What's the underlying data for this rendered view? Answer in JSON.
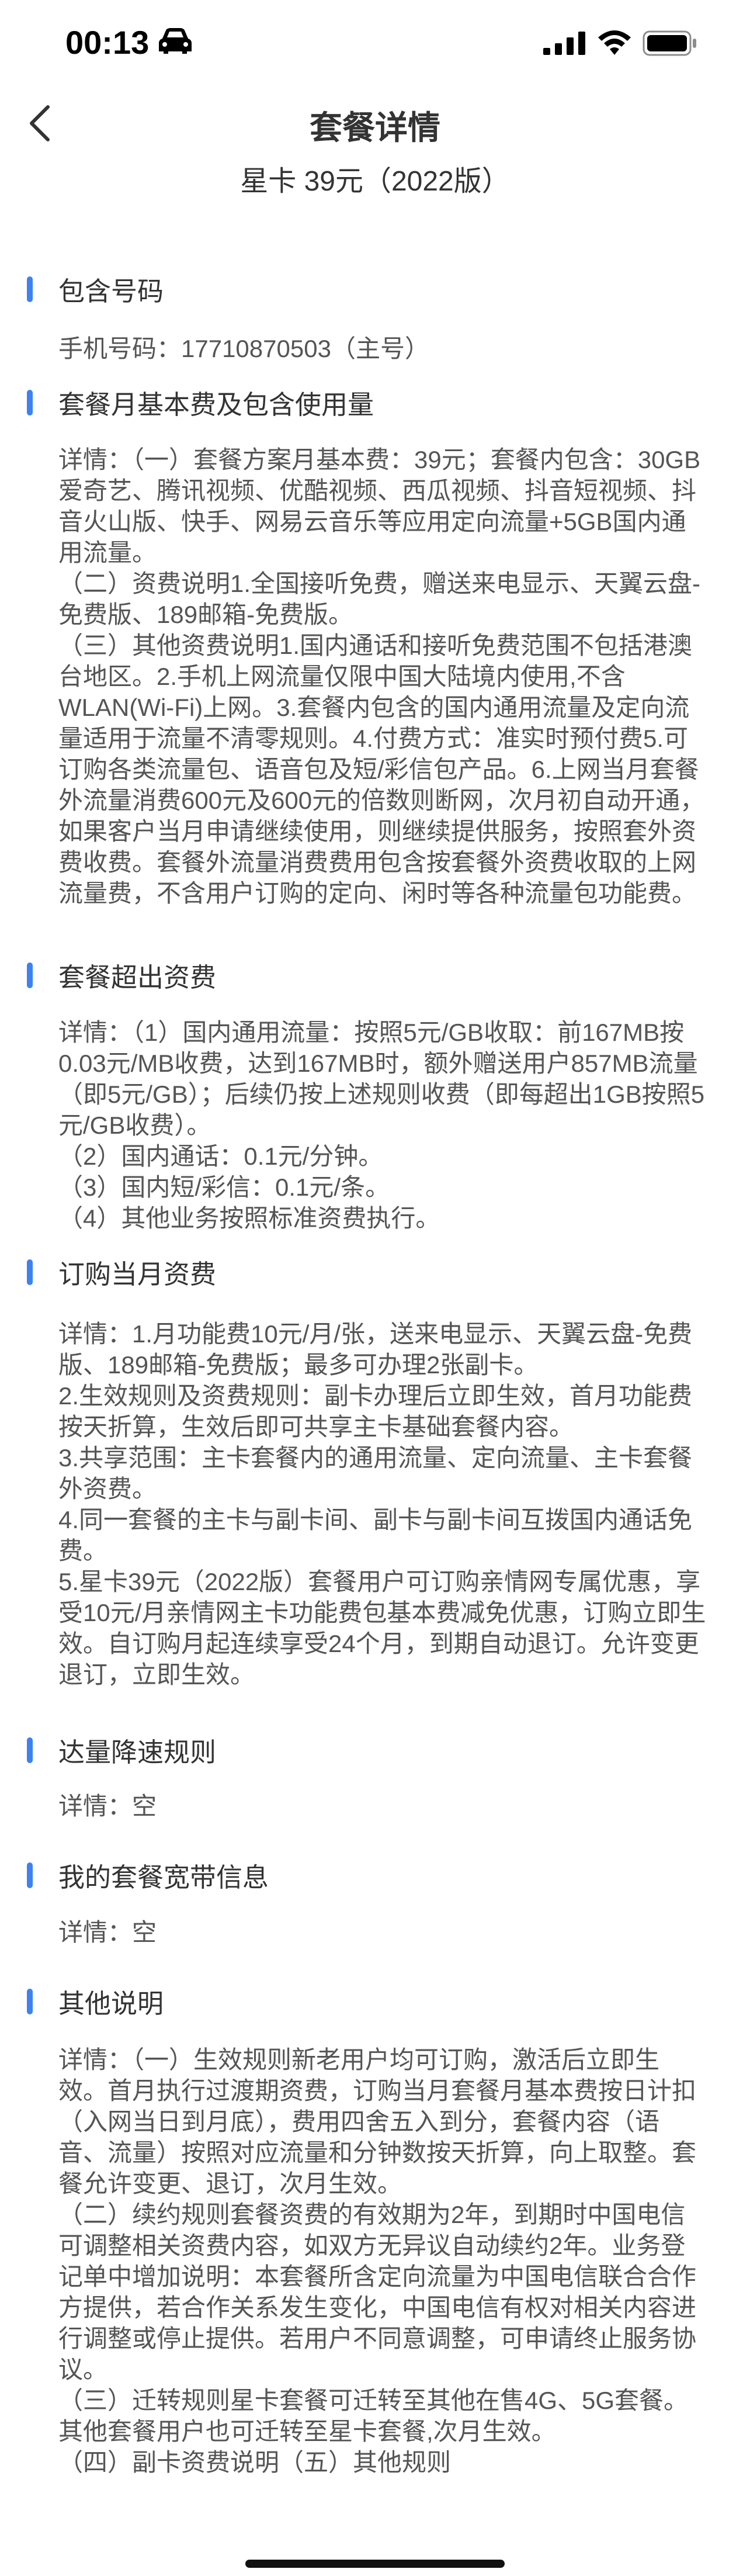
{
  "status_bar": {
    "time": "00:13",
    "icons": [
      "car-icon",
      "signal-icon",
      "wifi-icon",
      "battery-icon"
    ]
  },
  "nav": {
    "title": "套餐详情",
    "back_icon": "chevron-left-icon"
  },
  "plan_name": "星卡 39元（2022版）",
  "colors": {
    "accent": "#3b82f6",
    "text": "#333333",
    "body_text": "#555555"
  },
  "sections": [
    {
      "title": "包含号码",
      "body": "手机号码：17710870503（主号）"
    },
    {
      "title": "套餐月基本费及包含使用量",
      "body": "详情：（一）套餐方案月基本费：39元；套餐内包含：30GB爱奇艺、腾讯视频、优酷视频、西瓜视频、抖音短视频、抖音火山版、快手、网易云音乐等应用定向流量+5GB国内通用流量。\n（二）资费说明1.全国接听免费，赠送来电显示、天翼云盘-免费版、189邮箱-免费版。\n（三）其他资费说明1.国内通话和接听免费范围不包括港澳台地区。2.手机上网流量仅限中国大陆境内使用,不含WLAN(Wi-Fi)上网。3.套餐内包含的国内通用流量及定向流量适用于流量不清零规则。4.付费方式：准实时预付费5.可订购各类流量包、语音包及短/彩信包产品。6.上网当月套餐外流量消费600元及600元的倍数则断网，次月初自动开通，如果客户当月申请继续使用，则继续提供服务，按照套外资费收费。套餐外流量消费费用包含按套餐外资费收取的上网流量费，不含用户订购的定向、闲时等各种流量包功能费。"
    },
    {
      "title": "套餐超出资费",
      "body": "详情：（1）国内通用流量：按照5元/GB收取：前167MB按0.03元/MB收费，达到167MB时，额外赠送用户857MB流量（即5元/GB）；后续仍按上述规则收费（即每超出1GB按照5元/GB收费）。\n（2）国内通话：0.1元/分钟。\n（3）国内短/彩信：0.1元/条。\n（4）其他业务按照标准资费执行。"
    },
    {
      "title": "订购当月资费",
      "body": "详情：1.月功能费10元/月/张，送来电显示、天翼云盘-免费版、189邮箱-免费版；最多可办理2张副卡。\n2.生效规则及资费规则：副卡办理后立即生效，首月功能费按天折算，生效后即可共享主卡基础套餐内容。\n3.共享范围：主卡套餐内的通用流量、定向流量、主卡套餐外资费。\n4.同一套餐的主卡与副卡间、副卡与副卡间互拨国内通话免费。\n5.星卡39元（2022版）套餐用户可订购亲情网专属优惠，享受10元/月亲情网主卡功能费包基本费减免优惠，订购立即生效。自订购月起连续享受24个月，到期自动退订。允许变更退订，立即生效。"
    },
    {
      "title": "达量降速规则",
      "body": "详情：空"
    },
    {
      "title": "我的套餐宽带信息",
      "body": "详情：空"
    },
    {
      "title": "其他说明",
      "body": "详情：（一）生效规则新老用户均可订购，激活后立即生效。首月执行过渡期资费，订购当月套餐月基本费按日计扣（入网当日到月底），费用四舍五入到分，套餐内容（语音、流量）按照对应流量和分钟数按天折算，向上取整。套餐允许变更、退订，次月生效。\n（二）续约规则套餐资费的有效期为2年，到期时中国电信可调整相关资费内容，如双方无异议自动续约2年。业务登记单中增加说明：本套餐所含定向流量为中国电信联合合作方提供，若合作关系发生变化，中国电信有权对相关内容进行调整或停止提供。若用户不同意调整，可申请终止服务协议。\n（三）迁转规则星卡套餐可迁转至其他在售4G、5G套餐。其他套餐用户也可迁转至星卡套餐,次月生效。\n（四）副卡资费说明（五）其他规则"
    }
  ]
}
